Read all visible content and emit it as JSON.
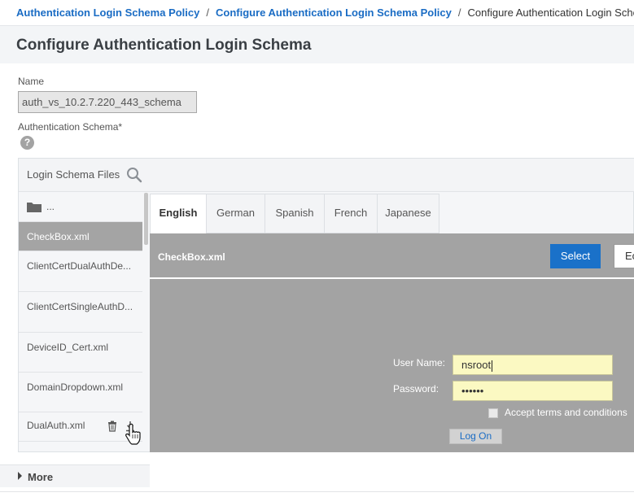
{
  "breadcrumb": {
    "items": [
      {
        "label": "Authentication Login Schema Policy"
      },
      {
        "label": "Configure Authentication Login Schema Policy"
      }
    ],
    "separator": "/",
    "current": "Configure Authentication Login Schema"
  },
  "page": {
    "title": "Configure Authentication Login Schema"
  },
  "form": {
    "name_label": "Name",
    "name_value": "auth_vs_10.2.7.220_443_schema",
    "schema_label": "Authentication Schema*",
    "help_icon": "question-circle-icon"
  },
  "files_panel": {
    "title": "Login Schema Files",
    "search_icon": "search-icon",
    "parent_folder_label": "...",
    "files": [
      {
        "label": "CheckBox.xml",
        "selected": true
      },
      {
        "label": "ClientCertDualAuthDe..."
      },
      {
        "label": "ClientCertSingleAuthD..."
      },
      {
        "label": "DeviceID_Cert.xml"
      },
      {
        "label": "DomainDropdown.xml"
      },
      {
        "label": "DualAuth.xml"
      }
    ]
  },
  "tabs": [
    {
      "label": "English",
      "active": true
    },
    {
      "label": "German"
    },
    {
      "label": "Spanish"
    },
    {
      "label": "French"
    },
    {
      "label": "Japanese"
    }
  ],
  "preview": {
    "file_name": "CheckBox.xml",
    "select_label": "Select",
    "edit_label": "Ec",
    "username_label": "User Name:",
    "username_value": "nsroot",
    "password_label": "Password:",
    "password_value": "••••••",
    "accept_label": "Accept terms and conditions",
    "logon_label": "Log On"
  },
  "more": {
    "label": "More"
  },
  "colors": {
    "link": "#1a6cc4",
    "primary_button": "#1a71c9",
    "preview_bg": "#a3a3a3",
    "selected_file": "#a4a4a4",
    "input_highlight": "#fbf9c2"
  }
}
